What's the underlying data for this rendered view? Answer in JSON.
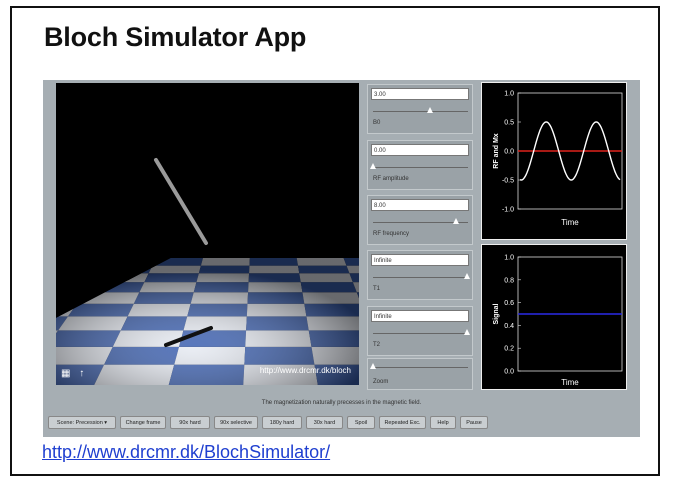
{
  "slide": {
    "title": "Bloch Simulator App",
    "link": "http://www.drcmr.dk/BlochSimulator/"
  },
  "viewport": {
    "url_overlay": "http://www.drcmr.dk/bloch",
    "icons": [
      "fullscreen-icon",
      "up-arrow-icon"
    ]
  },
  "controls": [
    {
      "value": "3.00",
      "label": "B0",
      "level": 0.6
    },
    {
      "value": "0.00",
      "label": "RF amplitude",
      "level": 0.0
    },
    {
      "value": "8.00",
      "label": "RF frequency",
      "level": 0.87
    },
    {
      "value": "Infinite",
      "label": "T1",
      "level": 0.99
    },
    {
      "value": "Infinite",
      "label": "T2",
      "level": 0.99
    },
    {
      "value": "",
      "label": "Zoom",
      "level": 0.0
    }
  ],
  "plots": {
    "rf": {
      "ylabel": "RF and Mx",
      "xlabel": "Time",
      "yticks": [
        "1.0",
        "0.5",
        "0.0",
        "-0.5",
        "-1.0"
      ],
      "colors": {
        "mx": "#ffffff",
        "rf": "#e0231c"
      }
    },
    "signal": {
      "ylabel": "Signal",
      "xlabel": "Time",
      "yticks": [
        "1.0",
        "0.8",
        "0.6",
        "0.4",
        "0.2",
        "0.0"
      ],
      "value": 0.5,
      "color": "#2a2ae8"
    }
  },
  "status_text": "The magnetization naturally precesses in the magnetic field.",
  "buttons": [
    "Scene: Precession",
    "Change frame",
    "90x hard",
    "90x selective",
    "180y hard",
    "30x hard",
    "Spoil",
    "Repeated Exc.",
    "Help",
    "Pause"
  ]
}
